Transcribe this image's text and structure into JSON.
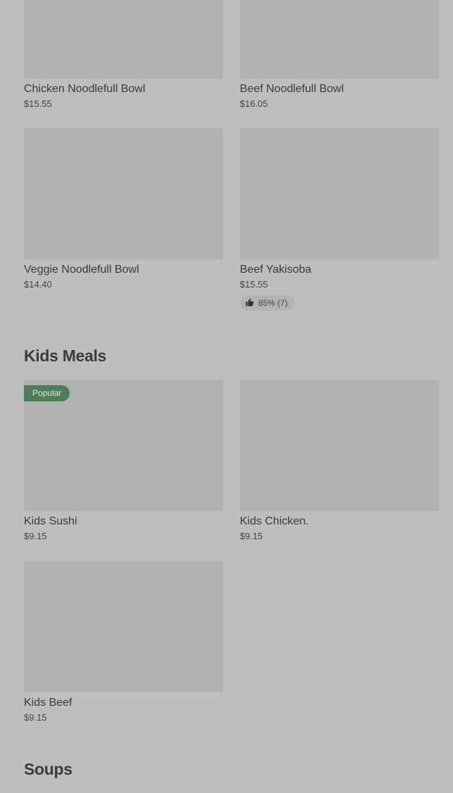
{
  "top_items": [
    {
      "name": "Chicken Noodlefull Bowl",
      "price": "$15.55"
    },
    {
      "name": "Beef Noodlefull Bowl",
      "price": "$16.05"
    },
    {
      "name": "Veggie Noodlefull Bowl",
      "price": "$14.40"
    },
    {
      "name": "Beef Yakisoba",
      "price": "$15.55",
      "rating": "85% (7)"
    }
  ],
  "sections": [
    {
      "title": "Kids Meals",
      "items": [
        {
          "name": "Kids Sushi",
          "price": "$9.15",
          "badge": "Popular"
        },
        {
          "name": "Kids Chicken.",
          "price": "$9.15"
        },
        {
          "name": "Kids Beef",
          "price": "$9.15"
        }
      ]
    },
    {
      "title": "Soups",
      "items": []
    }
  ],
  "colors": {
    "background": "#bebebe",
    "image_placeholder": "#b1b1b1",
    "badge": "#4e7c5c"
  }
}
